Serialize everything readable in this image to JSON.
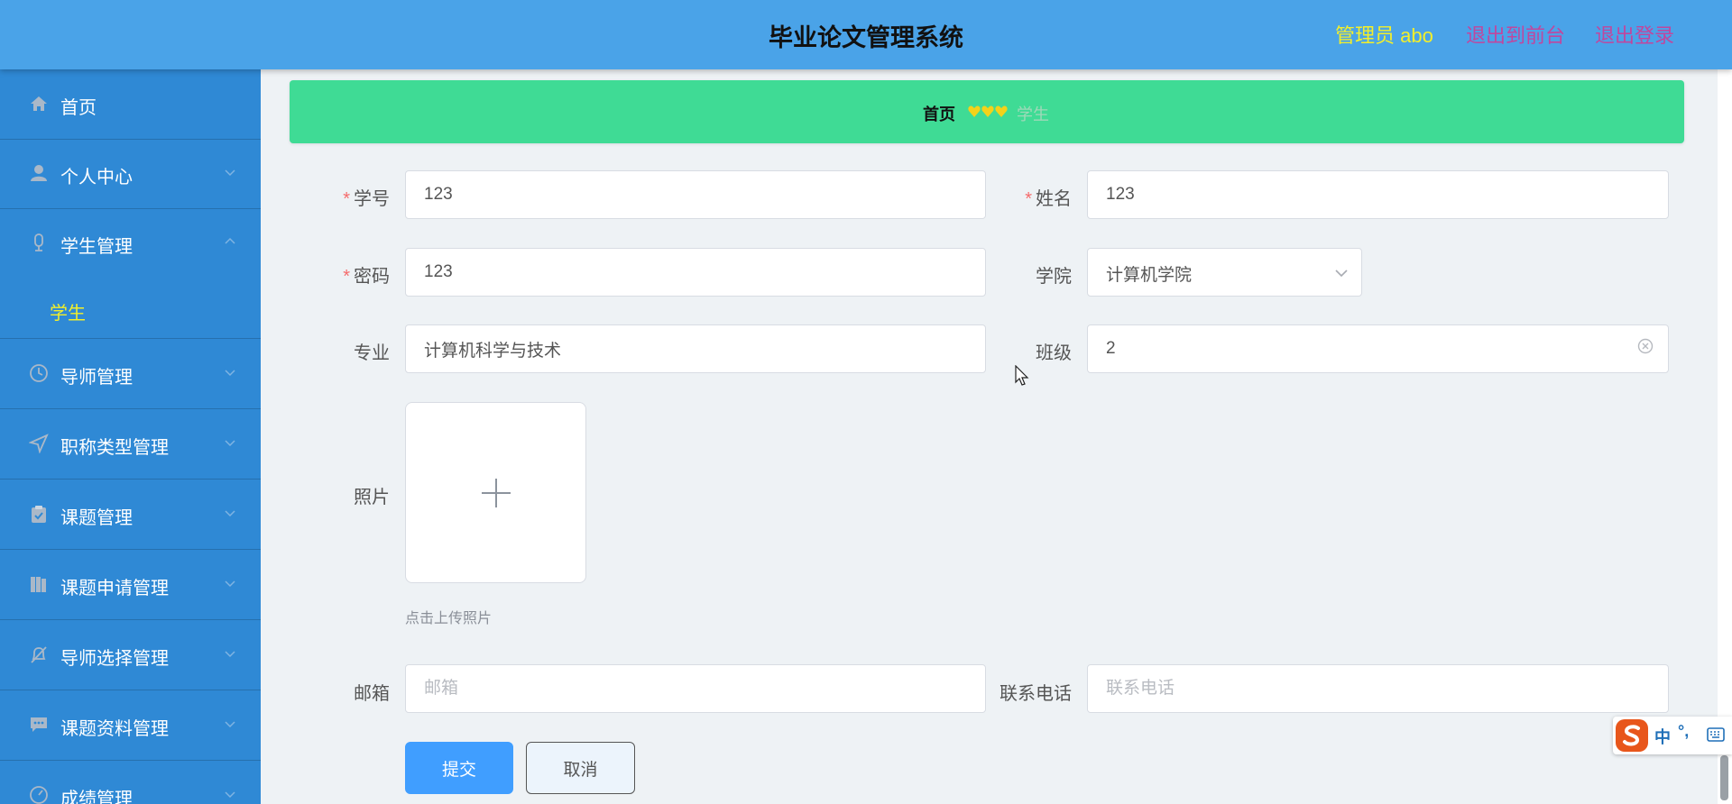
{
  "header": {
    "title": "毕业论文管理系统",
    "user": "管理员 abo",
    "front_link": "退出到前台",
    "logout_link": "退出登录"
  },
  "sidebar": {
    "items": [
      {
        "label": "首页",
        "icon": "home-icon"
      },
      {
        "label": "个人中心",
        "icon": "user-icon"
      },
      {
        "label": "学生管理",
        "icon": "student-icon",
        "expanded": true,
        "children": [
          {
            "label": "学生",
            "active": true
          }
        ]
      },
      {
        "label": "导师管理",
        "icon": "clock-icon"
      },
      {
        "label": "职称类型管理",
        "icon": "send-icon"
      },
      {
        "label": "课题管理",
        "icon": "clipboard-icon"
      },
      {
        "label": "课题申请管理",
        "icon": "books-icon"
      },
      {
        "label": "导师选择管理",
        "icon": "bell-off-icon"
      },
      {
        "label": "课题资料管理",
        "icon": "chat-icon"
      },
      {
        "label": "成绩管理",
        "icon": "gauge-icon"
      }
    ]
  },
  "breadcrumb": {
    "home": "首页",
    "current": "学生"
  },
  "form": {
    "student_id": {
      "label": "学号",
      "value": "123",
      "required": true
    },
    "name": {
      "label": "姓名",
      "value": "123",
      "required": true
    },
    "password": {
      "label": "密码",
      "value": "123",
      "required": true
    },
    "college": {
      "label": "学院",
      "value": "计算机学院"
    },
    "major": {
      "label": "专业",
      "value": "计算机科学与技术"
    },
    "class": {
      "label": "班级",
      "value": "2"
    },
    "photo": {
      "label": "照片",
      "tip": "点击上传照片"
    },
    "email": {
      "label": "邮箱",
      "value": "",
      "placeholder": "邮箱"
    },
    "phone": {
      "label": "联系电话",
      "value": "",
      "placeholder": "联系电话"
    },
    "submit_label": "提交",
    "cancel_label": "取消"
  },
  "ime": {
    "mode": "中",
    "punct": "°,"
  },
  "colors": {
    "header_bg": "#4aa3e8",
    "sidebar_bg": "#2f89d5",
    "breadcrumb_bg": "#3fdb95",
    "accent_yellow": "#f3ef2a",
    "link_magenta": "#c0479e",
    "primary_button": "#409eff"
  }
}
